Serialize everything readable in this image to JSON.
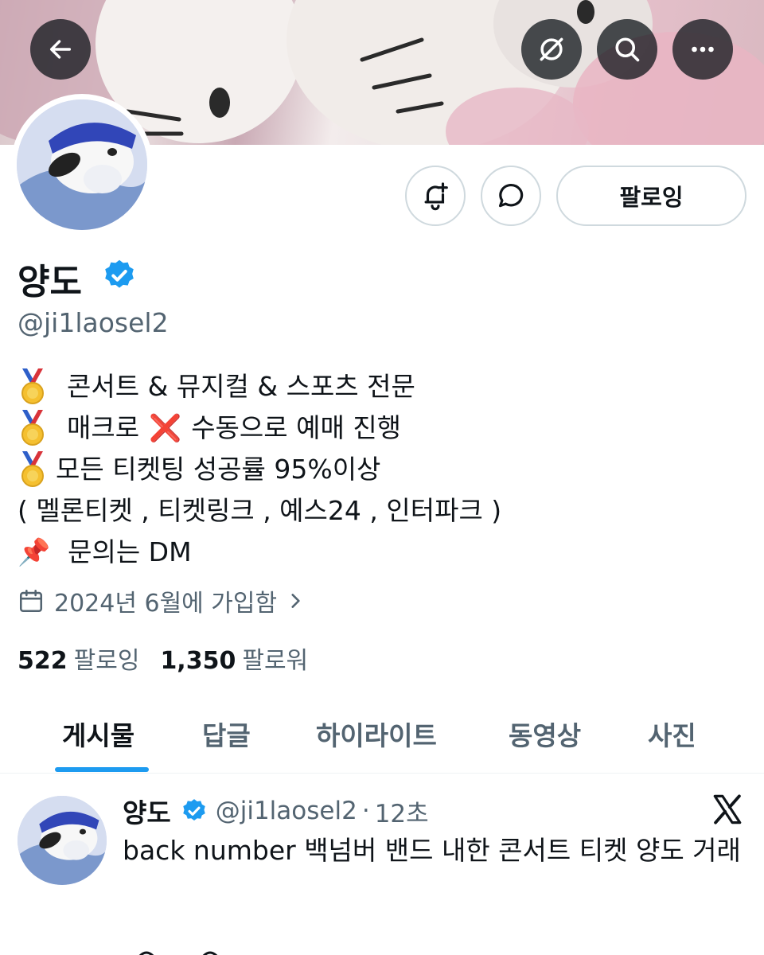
{
  "header": {
    "back_icon": "back-arrow-icon",
    "translate_icon": "grok-slash-icon",
    "search_icon": "search-icon",
    "more_icon": "more-dots-icon"
  },
  "profile": {
    "name": "양도",
    "handle": "@ji1laosel2",
    "follow_label": "팔로잉",
    "bio": {
      "line1": "콘서트 & 뮤지컬 & 스포츠 전문",
      "line2_a": "매크로",
      "line2_x": "❌",
      "line2_b": "수동으로 예매 진행",
      "line3": "모든 티켓팅 성공률 95%이상",
      "line4": "( 멜론티켓 , 티켓링크 , 예스24 , 인터파크 )",
      "line5_pin": "📌",
      "line5": "문의는 DM"
    },
    "joined": "2024년 6월에 가입함",
    "following_count": "522",
    "following_label": "팔로잉",
    "followers_count": "1,350",
    "followers_label": "팔로워"
  },
  "tabs": [
    {
      "label": "게시물"
    },
    {
      "label": "답글"
    },
    {
      "label": "하이라이트"
    },
    {
      "label": "동영상"
    },
    {
      "label": "사진"
    }
  ],
  "post": {
    "name": "양도",
    "handle": "@ji1laosel2",
    "dot": "·",
    "time": "12초",
    "text": "back number 백넘버 밴드 내한 콘서트 티켓 양도 거래"
  },
  "colors": {
    "accent": "#1d9bf0",
    "secondary_text": "#536471",
    "primary_text": "#0f1419",
    "border": "#cfd9de"
  }
}
